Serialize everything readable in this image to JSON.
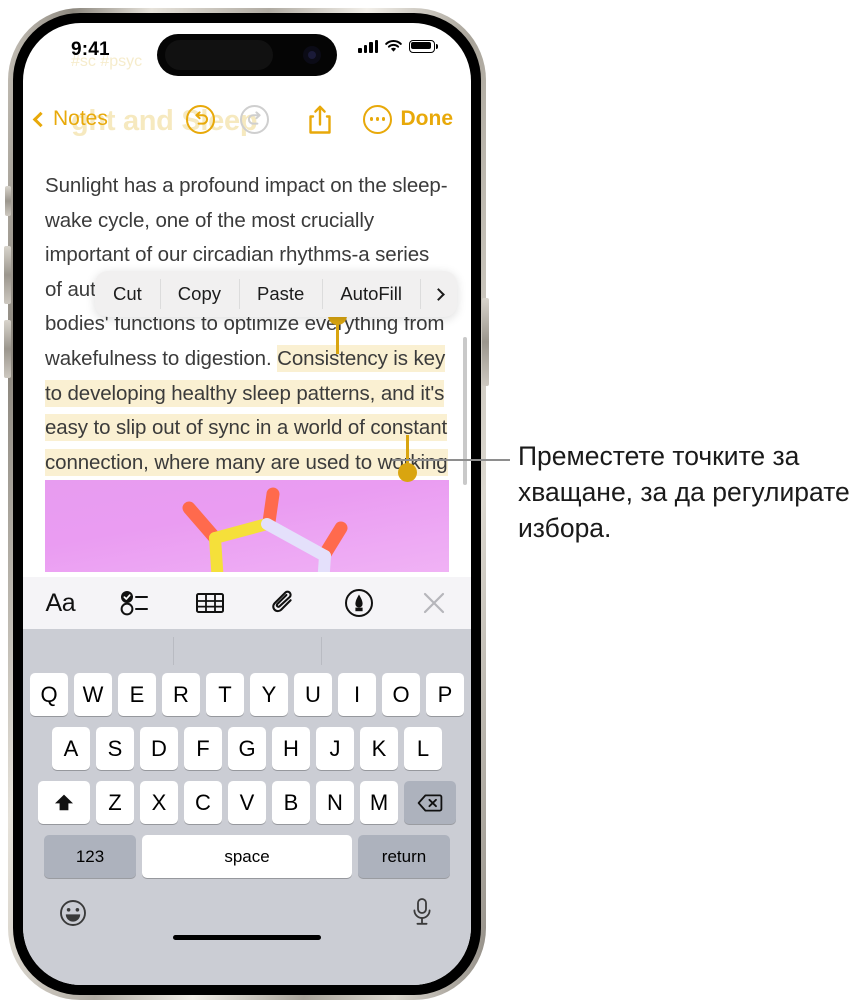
{
  "status_bar": {
    "time": "9:41",
    "signal_icon": "cellular-bars-icon",
    "wifi_icon": "wifi-icon",
    "battery_icon": "battery-full-icon"
  },
  "nav_bar": {
    "back_label": "Notes",
    "back_icon": "chevron-left-icon",
    "undo_icon": "undo-arrow-icon",
    "redo_icon": "redo-arrow-icon",
    "share_icon": "share-square-up-arrow-icon",
    "more_icon": "ellipsis-circle-icon",
    "done_label": "Done"
  },
  "ghost": {
    "tags": "#sc         #psyc",
    "title": "ght and Sleep"
  },
  "note": {
    "text_before": "Sunlight has a profound impact on the sleep-wake cycle, one of the most crucially important of our circadian rhythms-a series of automatic processes that regulate our bodies' functions to optimize everything from wakefulness to digestion. ",
    "text_selected": "Consistency is key to developing healthy sleep patterns, and it's easy to slip out of sync in a world of constant connection, where many are used to working across multiple timezones.",
    "attachment_name": "molecule-image",
    "selection_highlight_color": "#faf0d2",
    "handle_color": "#d9a510"
  },
  "context_menu": {
    "items": [
      {
        "label": "Cut"
      },
      {
        "label": "Copy"
      },
      {
        "label": "Paste"
      },
      {
        "label": "AutoFill"
      }
    ],
    "more_icon": "chevron-right-icon"
  },
  "edit_toolbar": {
    "items": [
      {
        "name": "format-aa-button",
        "label": "Aa"
      },
      {
        "name": "checklist-button",
        "label": ""
      },
      {
        "name": "table-button",
        "label": ""
      },
      {
        "name": "attach-button",
        "label": ""
      },
      {
        "name": "markup-button",
        "label": ""
      },
      {
        "name": "close-toolbar-button",
        "label": ""
      }
    ]
  },
  "keyboard": {
    "row1": [
      "Q",
      "W",
      "E",
      "R",
      "T",
      "Y",
      "U",
      "I",
      "O",
      "P"
    ],
    "row2": [
      "A",
      "S",
      "D",
      "F",
      "G",
      "H",
      "J",
      "K",
      "L"
    ],
    "row3": [
      "Z",
      "X",
      "C",
      "V",
      "B",
      "N",
      "M"
    ],
    "shift_icon": "shift-arrow-up-icon",
    "backspace_icon": "backspace-delete-icon",
    "numbers_label": "123",
    "space_label": "space",
    "return_label": "return",
    "emoji_icon": "emoji-smiley-icon",
    "dictation_icon": "microphone-icon"
  },
  "callout": {
    "text": "Преместете точките за хващане, за да регулирате избора."
  },
  "colors": {
    "accent": "#e8a90a",
    "handle": "#d9a510",
    "selection": "#faf0d2",
    "keyboard_bg": "#cbcdd4",
    "toolbar_bg": "#f5f4f7"
  }
}
